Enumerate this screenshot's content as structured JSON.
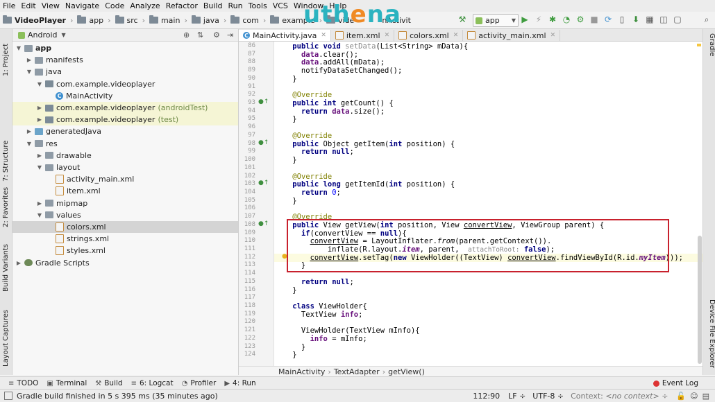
{
  "menu": [
    "File",
    "Edit",
    "View",
    "Navigate",
    "Code",
    "Analyze",
    "Refactor",
    "Build",
    "Run",
    "Tools",
    "VCS",
    "Window",
    "Help"
  ],
  "nav": {
    "project": "VideoPlayer",
    "crumbs": [
      "app",
      "src",
      "main",
      "java",
      "com",
      "example",
      "vide"
    ],
    "tail": "nActivit"
  },
  "brand": {
    "a": "uth",
    "b": "e",
    "c": "na"
  },
  "toolbar": {
    "run_config": "app"
  },
  "left_tabs": [
    "1: Project",
    "7: Structure",
    "2: Favorites",
    "Build Variants",
    "Layout Captures"
  ],
  "right_tabs": [
    "Gradle",
    "Device File Explorer"
  ],
  "project_panel": {
    "view_mode": "Android",
    "tree": [
      {
        "label": "app",
        "bold": true,
        "depth": 0,
        "arrow": "▼",
        "icon": "folder"
      },
      {
        "label": "manifests",
        "depth": 1,
        "arrow": "▶",
        "icon": "folder"
      },
      {
        "label": "java",
        "depth": 1,
        "arrow": "▼",
        "icon": "folder"
      },
      {
        "label": "com.example.videoplayer",
        "depth": 2,
        "arrow": "▼",
        "icon": "pkg"
      },
      {
        "label": "MainActivity",
        "depth": 3,
        "arrow": "",
        "icon": "cls"
      },
      {
        "label": "com.example.videoplayer",
        "suffix": "(androidTest)",
        "depth": 2,
        "arrow": "▶",
        "icon": "pkg",
        "hl": true
      },
      {
        "label": "com.example.videoplayer",
        "suffix": "(test)",
        "depth": 2,
        "arrow": "▶",
        "icon": "pkg",
        "hl": true
      },
      {
        "label": "generatedJava",
        "depth": 1,
        "arrow": "▶",
        "icon": "src"
      },
      {
        "label": "res",
        "depth": 1,
        "arrow": "▼",
        "icon": "folder"
      },
      {
        "label": "drawable",
        "depth": 2,
        "arrow": "▶",
        "icon": "folder"
      },
      {
        "label": "layout",
        "depth": 2,
        "arrow": "▼",
        "icon": "folder"
      },
      {
        "label": "activity_main.xml",
        "depth": 3,
        "arrow": "",
        "icon": "xml"
      },
      {
        "label": "item.xml",
        "depth": 3,
        "arrow": "",
        "icon": "xml"
      },
      {
        "label": "mipmap",
        "depth": 2,
        "arrow": "▶",
        "icon": "folder"
      },
      {
        "label": "values",
        "depth": 2,
        "arrow": "▼",
        "icon": "folder"
      },
      {
        "label": "colors.xml",
        "depth": 3,
        "arrow": "",
        "icon": "xml",
        "sel": true
      },
      {
        "label": "strings.xml",
        "depth": 3,
        "arrow": "",
        "icon": "xml"
      },
      {
        "label": "styles.xml",
        "depth": 3,
        "arrow": "",
        "icon": "xml"
      },
      {
        "label": "Gradle Scripts",
        "depth": 0,
        "arrow": "▶",
        "icon": "grad"
      }
    ]
  },
  "editor_tabs": [
    {
      "label": "MainActivity.java",
      "active": true,
      "icon": "cls"
    },
    {
      "label": "item.xml",
      "icon": "xml"
    },
    {
      "label": "colors.xml",
      "icon": "xml"
    },
    {
      "label": "activity_main.xml",
      "icon": "xml"
    }
  ],
  "code_lines": [
    {
      "n": "86",
      "html": "    <span class='k'>public void</span> <span class='hint' style='font-size:10.5px'>setData</span>(List&lt;String&gt; mData){"
    },
    {
      "n": "87",
      "html": "      <span class='fld'>data</span>.clear();"
    },
    {
      "n": "88",
      "html": "      <span class='fld'>data</span>.addAll(mData);"
    },
    {
      "n": "89",
      "html": "      notifyDataSetChanged();"
    },
    {
      "n": "90",
      "html": "    }"
    },
    {
      "n": "91",
      "html": ""
    },
    {
      "n": "92",
      "html": "    <span class='an'>@Override</span>"
    },
    {
      "n": "93",
      "html": "    <span class='k'>public int</span> getCount() {",
      "mark": true
    },
    {
      "n": "94",
      "html": "      <span class='k'>return</span> <span class='fld'>data</span>.size();"
    },
    {
      "n": "95",
      "html": "    }"
    },
    {
      "n": "96",
      "html": ""
    },
    {
      "n": "97",
      "html": "    <span class='an'>@Override</span>"
    },
    {
      "n": "98",
      "html": "    <span class='k'>public</span> Object getItem(<span class='k'>int</span> position) {",
      "mark": true
    },
    {
      "n": "99",
      "html": "      <span class='k'>return null</span>;"
    },
    {
      "n": "100",
      "html": "    }"
    },
    {
      "n": "101",
      "html": ""
    },
    {
      "n": "102",
      "html": "    <span class='an'>@Override</span>"
    },
    {
      "n": "103",
      "html": "    <span class='k'>public long</span> getItemId(<span class='k'>int</span> position) {",
      "mark": true
    },
    {
      "n": "104",
      "html": "      <span class='k'>return</span> <span class='num'>0</span>;"
    },
    {
      "n": "105",
      "html": "    }"
    },
    {
      "n": "106",
      "html": ""
    },
    {
      "n": "107",
      "html": "    <span class='an'>@Override</span>"
    },
    {
      "n": "108",
      "html": "    <span class='k'>public</span> View getView(<span class='k'>int</span> position, View <span class='ul'>convertView</span>, ViewGroup parent) {",
      "mark": true
    },
    {
      "n": "109",
      "html": "      <span class='k'>if</span>(convertView == <span class='k'>null</span>){"
    },
    {
      "n": "110",
      "html": "        <span class='ul'>convertView</span> = LayoutInflater.<span class='it'>from</span>(parent.getContext())."
    },
    {
      "n": "111",
      "html": "            inflate(R.layout.<span class='fld it'>item</span>, parent,  <span class='hint'>attachToRoot:</span> <span class='k'>false</span>);"
    },
    {
      "n": "112",
      "html": "        <span class='ul'>convertView</span>.setTag(<span class='k'>new</span> ViewHolder((TextView) <span class='ul'>convertView</span>.findViewById(R.id.<span class='fld it'>myItem</span>)));",
      "cur": true
    },
    {
      "n": "113",
      "html": "      }"
    },
    {
      "n": "114",
      "html": ""
    },
    {
      "n": "115",
      "html": "      <span class='k'>return null</span>;"
    },
    {
      "n": "116",
      "html": "    }"
    },
    {
      "n": "117",
      "html": ""
    },
    {
      "n": "118",
      "html": "    <span class='k'>class</span> ViewHolder{"
    },
    {
      "n": "119",
      "html": "      TextView <span class='fld'>info</span>;"
    },
    {
      "n": "120",
      "html": ""
    },
    {
      "n": "121",
      "html": "      ViewHolder(TextView mInfo){"
    },
    {
      "n": "122",
      "html": "        <span class='fld'>info</span> = mInfo;"
    },
    {
      "n": "123",
      "html": "      }"
    },
    {
      "n": "124",
      "html": "    }"
    }
  ],
  "editor_breadcrumb": [
    "MainActivity",
    "TextAdapter",
    "getView()"
  ],
  "tool_tabs": [
    {
      "label": "TODO",
      "icon": "≡"
    },
    {
      "label": "Terminal",
      "icon": "▣"
    },
    {
      "label": "Build",
      "icon": "⚒"
    },
    {
      "label": "6: Logcat",
      "icon": "≡"
    },
    {
      "label": "Profiler",
      "icon": "◔"
    },
    {
      "label": "4: Run",
      "icon": "▶"
    }
  ],
  "event_log": "Event Log",
  "status": {
    "message": "Gradle build finished in 5 s 395 ms (35 minutes ago)",
    "position": "112:90",
    "line_sep": "LF",
    "encoding": "UTF-8",
    "context_label": "Context:",
    "context_value": "<no context>"
  }
}
